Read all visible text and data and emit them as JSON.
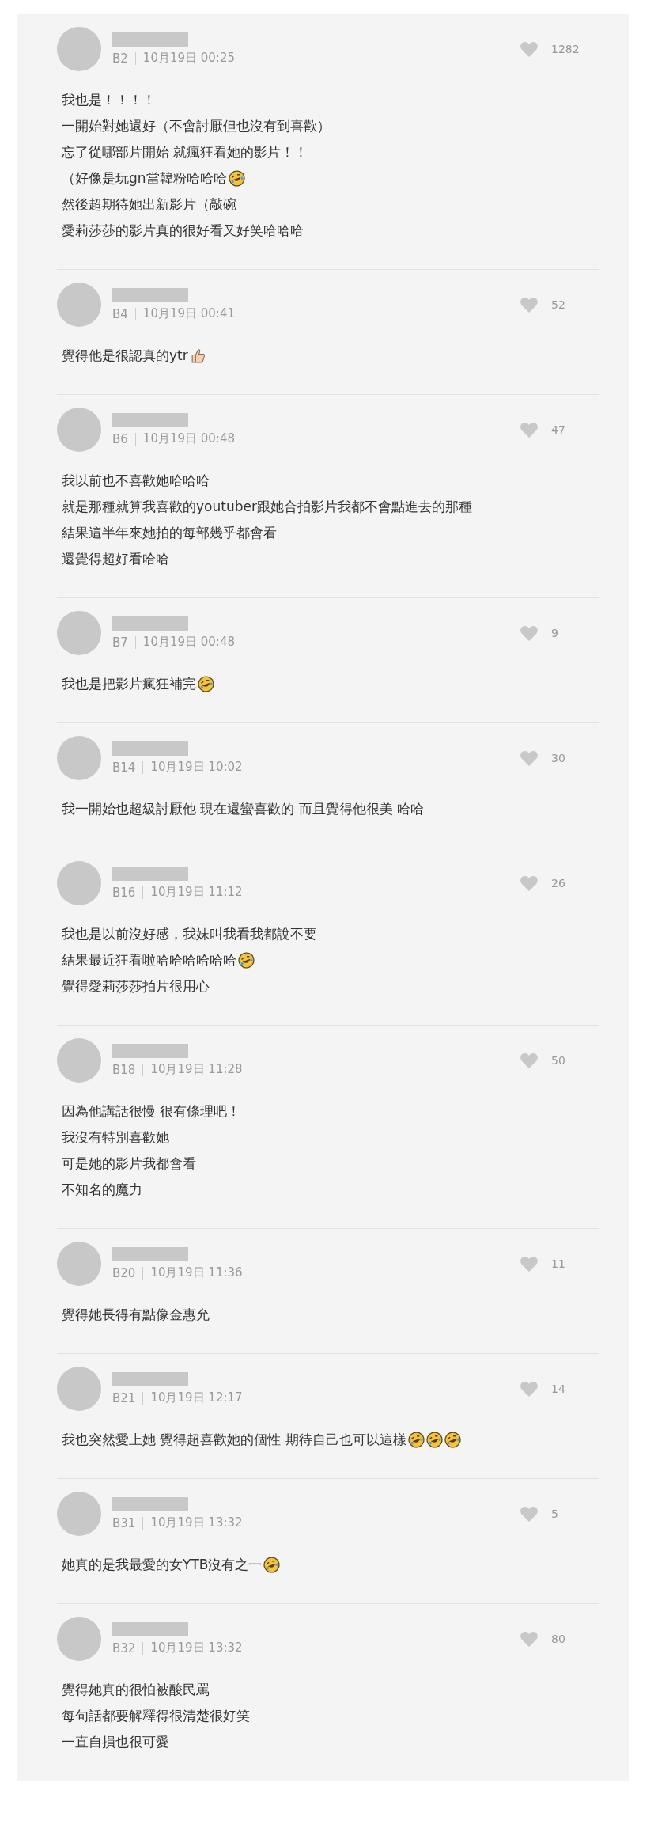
{
  "comments": [
    {
      "floor": "B2",
      "time": "10月19日 00:25",
      "likes": "1282",
      "lines": [
        {
          "text": "我也是！！！！"
        },
        {
          "text": "一開始對她還好（不會討厭但也沒有到喜歡）"
        },
        {
          "text": "忘了從哪部片開始 就瘋狂看她的影片！！"
        },
        {
          "text": "（好像是玩gn當韓粉哈哈哈",
          "emojis": [
            {
              "kind": "laugh"
            }
          ]
        },
        {
          "text": "然後超期待她出新影片（敲碗"
        },
        {
          "text": "愛莉莎莎的影片真的很好看又好笑哈哈哈"
        }
      ]
    },
    {
      "floor": "B4",
      "time": "10月19日 00:41",
      "likes": "52",
      "lines": [
        {
          "text": "覺得他是很認真的ytr",
          "emojis": [
            {
              "kind": "thumb"
            }
          ]
        }
      ]
    },
    {
      "floor": "B6",
      "time": "10月19日 00:48",
      "likes": "47",
      "lines": [
        {
          "text": "我以前也不喜歡她哈哈哈"
        },
        {
          "text": "就是那種就算我喜歡的youtuber跟她合拍影片我都不會點進去的那種"
        },
        {
          "text": "結果這半年來她拍的每部幾乎都會看"
        },
        {
          "text": "還覺得超好看哈哈"
        }
      ]
    },
    {
      "floor": "B7",
      "time": "10月19日 00:48",
      "likes": "9",
      "lines": [
        {
          "text": "我也是把影片瘋狂補完",
          "emojis": [
            {
              "kind": "laugh"
            }
          ]
        }
      ]
    },
    {
      "floor": "B14",
      "time": "10月19日 10:02",
      "likes": "30",
      "lines": [
        {
          "text": "我一開始也超級討厭他 現在還蠻喜歡的 而且覺得他很美 哈哈"
        }
      ]
    },
    {
      "floor": "B16",
      "time": "10月19日 11:12",
      "likes": "26",
      "lines": [
        {
          "text": "我也是以前沒好感，我妹叫我看我都說不要"
        },
        {
          "text": "結果最近狂看啦哈哈哈哈哈哈",
          "emojis": [
            {
              "kind": "laugh"
            }
          ]
        },
        {
          "text": "覺得愛莉莎莎拍片很用心"
        }
      ]
    },
    {
      "floor": "B18",
      "time": "10月19日 11:28",
      "likes": "50",
      "lines": [
        {
          "text": "因為他講話很慢 很有條理吧！"
        },
        {
          "text": "我沒有特別喜歡她"
        },
        {
          "text": "可是她的影片我都會看"
        },
        {
          "text": "不知名的魔力"
        }
      ]
    },
    {
      "floor": "B20",
      "time": "10月19日 11:36",
      "likes": "11",
      "lines": [
        {
          "text": "覺得她長得有點像金惠允"
        }
      ]
    },
    {
      "floor": "B21",
      "time": "10月19日 12:17",
      "likes": "14",
      "lines": [
        {
          "text": "我也突然愛上她 覺得超喜歡她的個性 期待自己也可以這樣",
          "emojis": [
            {
              "kind": "laugh"
            },
            {
              "kind": "laugh"
            },
            {
              "kind": "laugh"
            }
          ]
        }
      ]
    },
    {
      "floor": "B31",
      "time": "10月19日 13:32",
      "likes": "5",
      "lines": [
        {
          "text": "她真的是我最愛的女YTB沒有之一",
          "emojis": [
            {
              "kind": "laugh"
            }
          ]
        }
      ]
    },
    {
      "floor": "B32",
      "time": "10月19日 13:32",
      "likes": "80",
      "lines": [
        {
          "text": "覺得她真的很怕被酸民罵"
        },
        {
          "text": "每句話都要解釋得很清楚很好笑"
        },
        {
          "text": "一直自損也很可愛"
        }
      ]
    }
  ]
}
